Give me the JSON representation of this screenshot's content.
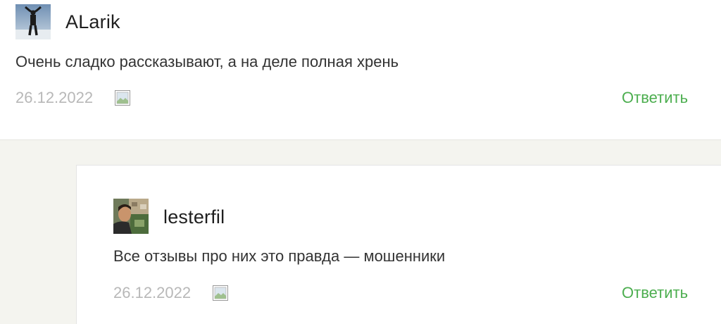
{
  "comments": [
    {
      "author": "ALarik",
      "text": "Очень сладко рассказывают, а на деле полная хрень",
      "date": "26.12.2022",
      "reply_label": "Ответить"
    },
    {
      "author": "lesterfil",
      "text": "Все отзывы про них это правда — мошенники",
      "date": "26.12.2022",
      "reply_label": "Ответить"
    }
  ],
  "colors": {
    "reply": "#4cae4f",
    "date": "#b8b8b8",
    "thread_background": "#f4f4ef"
  },
  "icons": {
    "attachment": "broken-image-icon"
  }
}
